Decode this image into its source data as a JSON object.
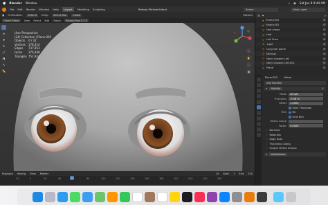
{
  "mac_menu": {
    "apple": "",
    "app": "Blender",
    "items": [
      "Window"
    ],
    "clock": "Sat Jan 8 9:44 AM"
  },
  "top_bar": {
    "menus": [
      "File",
      "Edit",
      "Render",
      "Window",
      "Help"
    ],
    "workspaces": [
      "Layout",
      "Modeling",
      "Sculpting",
      "UV Editing",
      "Texture Paint",
      "Shading",
      "Animation",
      "Rendering",
      "Compositing",
      "Geometry Nodes",
      "Scripting"
    ],
    "active_workspace": "Layout",
    "file_title": "Retopo Michael.blend",
    "scene": "Scene",
    "view_layer": "View Layer"
  },
  "viewport_header": {
    "orientation_label": "Orientation:",
    "orientation_value": "Default",
    "drag_label": "Drag:",
    "drag_value": "Select Box",
    "transform": "Global",
    "options": "Options"
  },
  "viewport_header2": {
    "mode": "Object Mode",
    "menus": [
      "View",
      "Select",
      "Add",
      "Object"
    ],
    "retopoflow": "RetopoFlow 3.2.5"
  },
  "overlay": {
    "view_name": "User Perspective",
    "collection": "(24) Collection | Plane.002",
    "stats": [
      {
        "label": "Objects",
        "value": "0 / 32"
      },
      {
        "label": "Vertices",
        "value": "178,414"
      },
      {
        "label": "Edges",
        "value": "737,953"
      },
      {
        "label": "Faces",
        "value": "376,448"
      },
      {
        "label": "Triangles",
        "value": "752,924"
      }
    ]
  },
  "timeline": {
    "menus": [
      "Playback",
      "Keying",
      "View",
      "Marker"
    ],
    "current_frame": "24",
    "start_label": "Start",
    "start": "1",
    "end_label": "End",
    "end": "250",
    "ticks": [
      "-20",
      "0",
      "20",
      "40",
      "60",
      "80",
      "100",
      "120",
      "140",
      "160",
      "180",
      "200",
      "220",
      "240",
      "260"
    ]
  },
  "outliner": {
    "items": [
      {
        "name": "Empty.001"
      },
      {
        "name": "Empty.002"
      },
      {
        "name": "Hair shape"
      },
      {
        "name": "Hair"
      },
      {
        "name": "Left Shoe"
      },
      {
        "name": "Light"
      },
      {
        "name": "Long hair plane"
      },
      {
        "name": "Michael"
      },
      {
        "name": "Navy Sneaker Left"
      },
      {
        "name": "Navy Sneaker Left.001"
      },
      {
        "name": "Plane"
      }
    ]
  },
  "properties": {
    "object_name": "Plane.002",
    "modifier_label": "Mirror",
    "add_modifier": "Add Modifier",
    "modifier_name": "Solidify",
    "fields": [
      {
        "label": "Mode",
        "value": "Simple"
      },
      {
        "label": "Thickness",
        "value": "-0.06 m"
      },
      {
        "label": "Offset",
        "value": "1.0000"
      }
    ],
    "even_thickness": "Even Thickness",
    "rim_label": "Rim",
    "fill": "Fill",
    "only_rim": "Only Rim",
    "vertex_group_label": "Vertex Group",
    "factor_label": "Factor",
    "factor_value": "0.0000",
    "sections": [
      "Normals",
      "Materials",
      "Edge Data",
      "Thickness Clamp",
      "Output Vertex Groups"
    ],
    "subdivision": "Subdivision"
  },
  "colors": {
    "accent": "#4772b3",
    "blender_orange": "#e87d0d"
  }
}
